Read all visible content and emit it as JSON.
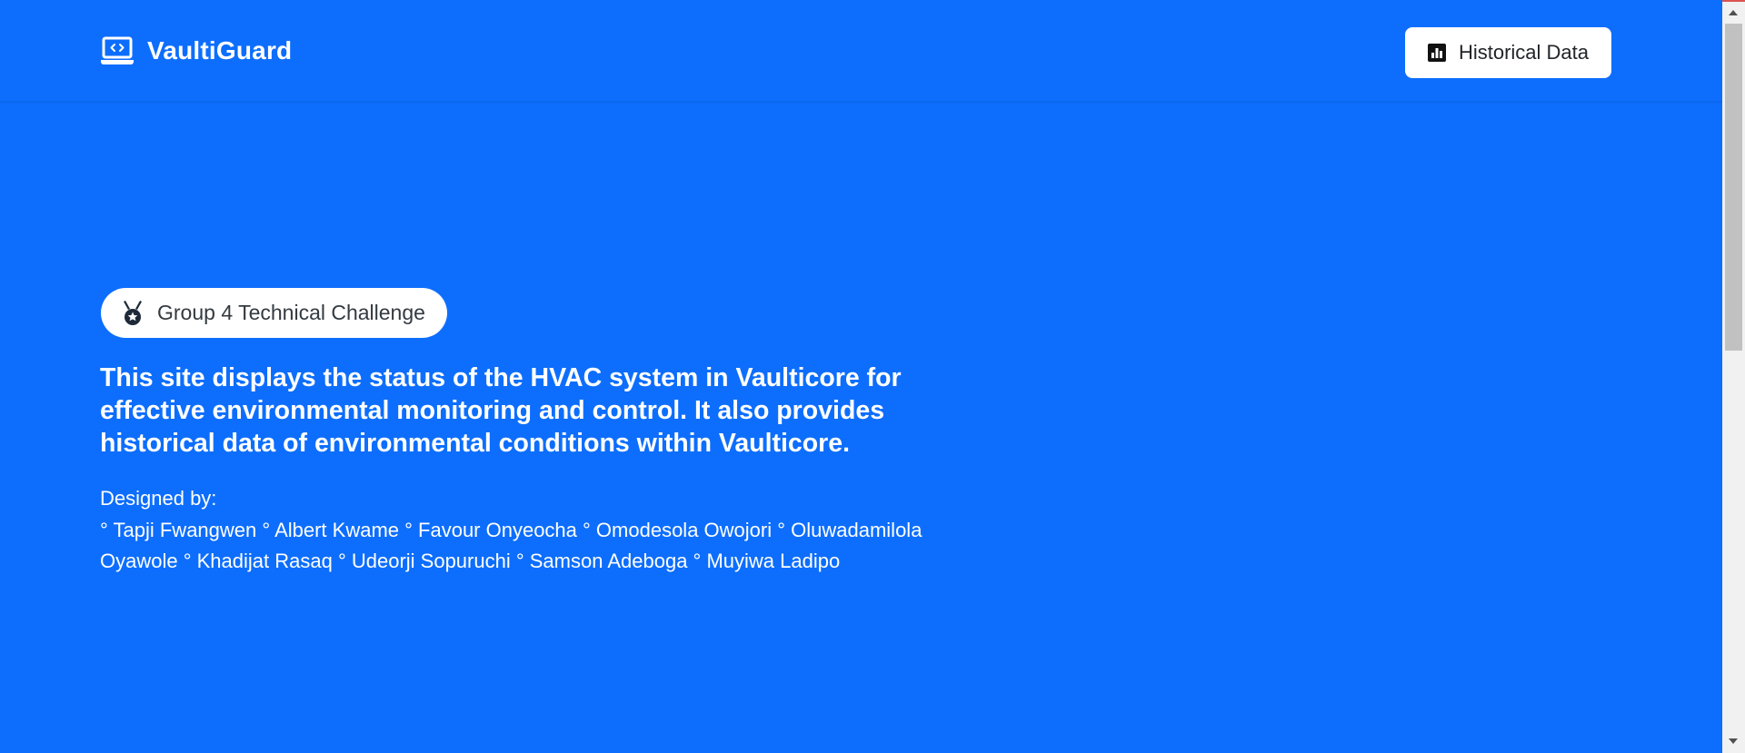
{
  "navbar": {
    "brand_icon": "laptop-code-icon",
    "brand_name": "VaultiGuard",
    "historical_button": {
      "icon": "bar-chart-icon",
      "label": "Historical Data"
    }
  },
  "hero": {
    "badge": {
      "icon": "award-medal-icon",
      "label": "Group 4 Technical Challenge"
    },
    "headline": "This site displays the status of the HVAC system in Vaulticore for effective environmental monitoring and control. It also provides historical data of environmental conditions within Vaulticore.",
    "designed_label": "Designed by:",
    "designers": "° Tapji Fwangwen ° Albert Kwame ° Favour Onyeocha ° Omodesola Owojori ° Oluwadamilola Oyawole ° Khadijat Rasaq ° Udeorji Sopuruchi ° Samson Adeboga ° Muyiwa Ladipo"
  },
  "colors": {
    "background": "#0d6efd",
    "text": "#ffffff",
    "button_bg": "#ffffff"
  }
}
